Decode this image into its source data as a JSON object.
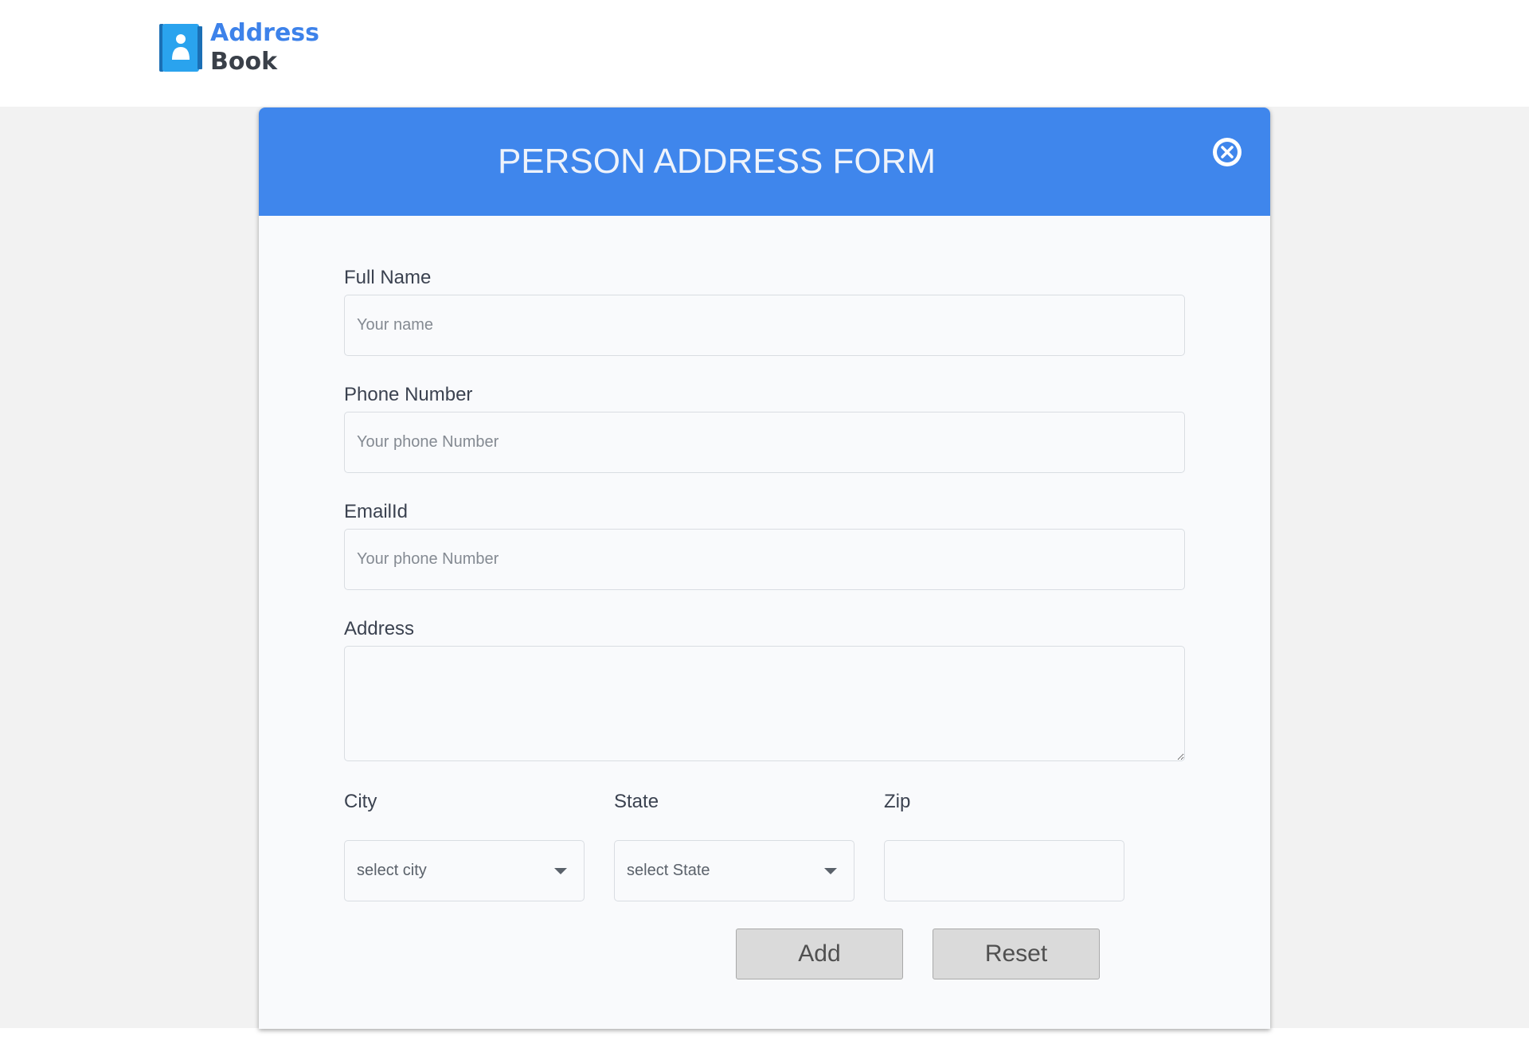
{
  "app": {
    "logo_line1": "Address",
    "logo_line2": "Book"
  },
  "form": {
    "title": "PERSON ADDRESS FORM",
    "fields": {
      "full_name": {
        "label": "Full Name",
        "placeholder": "Your name"
      },
      "phone": {
        "label": "Phone Number",
        "placeholder": "Your phone Number"
      },
      "email": {
        "label": "EmailId",
        "placeholder": "Your phone Number"
      },
      "address": {
        "label": "Address",
        "placeholder": ""
      },
      "city": {
        "label": "City",
        "selected": "select city"
      },
      "state": {
        "label": "State",
        "selected": "select State"
      },
      "zip": {
        "label": "Zip",
        "placeholder": ""
      }
    },
    "buttons": {
      "add": "Add",
      "reset": "Reset"
    }
  },
  "colors": {
    "accent": "#3f86ec",
    "logo_blue": "#3d82ea",
    "logo_dark": "#3a4049"
  },
  "icons": {
    "logo": "address-book-icon",
    "close": "close-circle-icon",
    "dropdown": "caret-down-icon"
  }
}
